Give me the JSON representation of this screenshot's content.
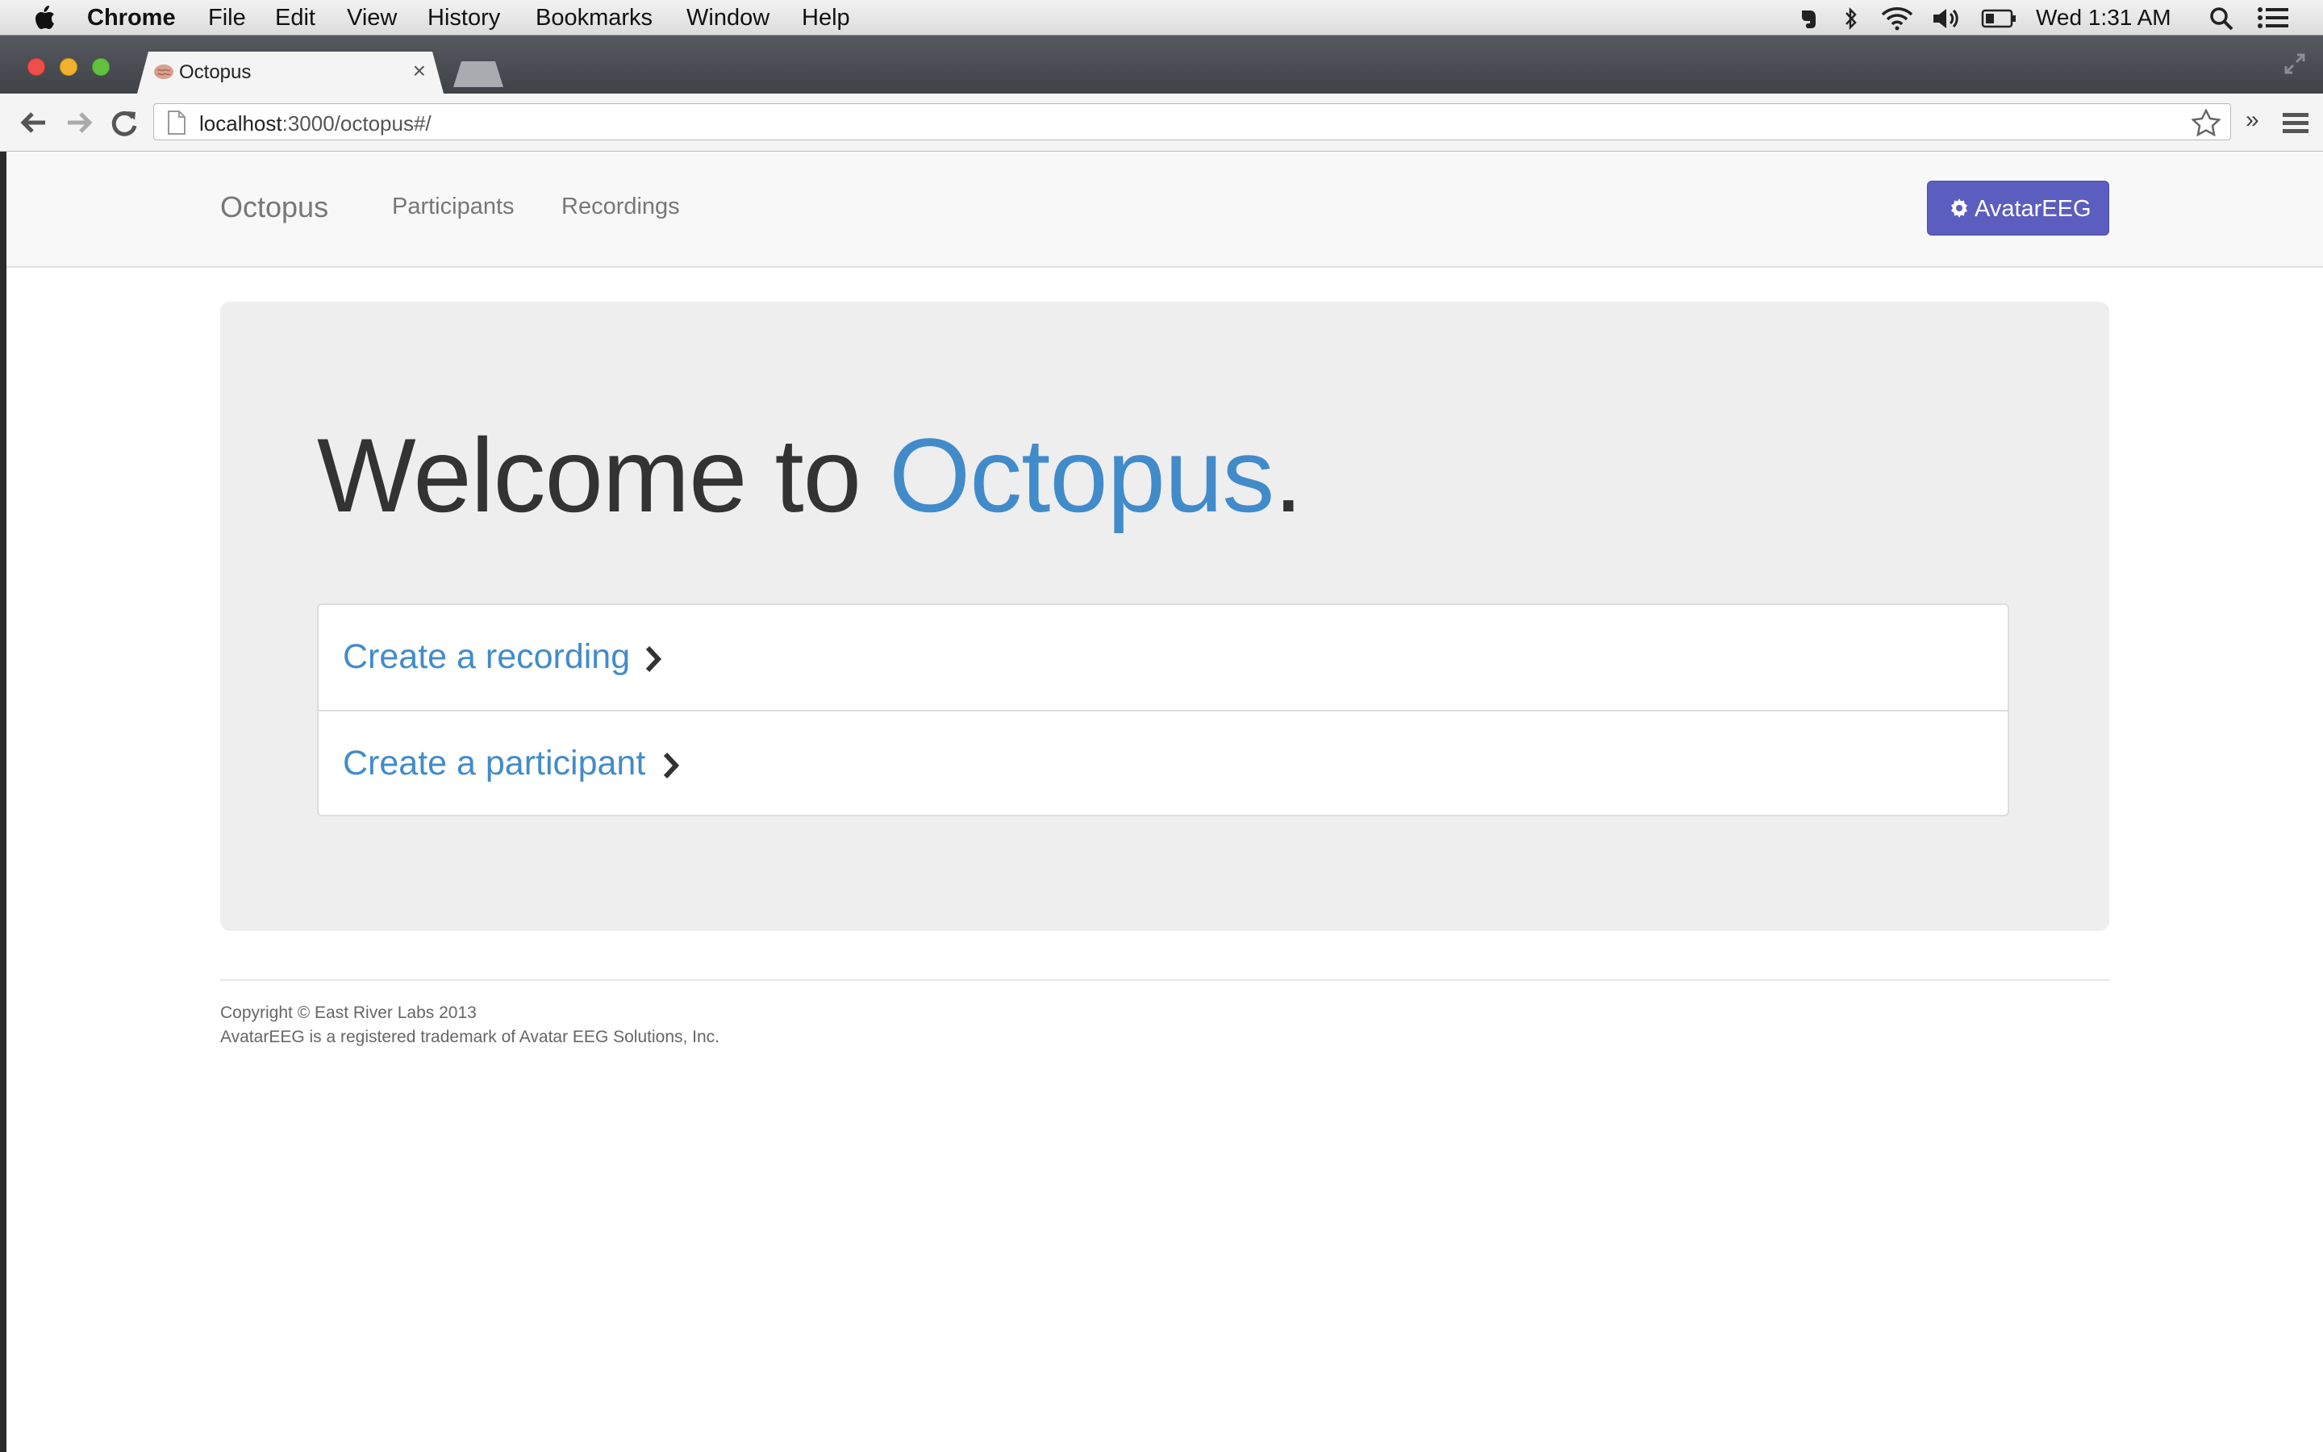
{
  "menubar": {
    "apple": "",
    "app_name": "Chrome",
    "items": [
      "File",
      "Edit",
      "View",
      "History",
      "Bookmarks",
      "Window",
      "Help"
    ],
    "clock": "Wed 1:31 AM",
    "status_icons": [
      "evernote-icon",
      "bluetooth-icon",
      "wifi-icon",
      "volume-icon",
      "battery-icon",
      "spotlight-icon",
      "notification-center-icon"
    ]
  },
  "browser": {
    "tab_title": "Octopus",
    "tab_close": "×",
    "url_host": "localhost",
    "url_path": ":3000/octopus#/",
    "ext_chevron": "»"
  },
  "app": {
    "brand": "Octopus",
    "nav": [
      "Participants",
      "Recordings"
    ],
    "account_button": "AvatarEEG",
    "accent_color": "#428bca",
    "button_color": "#5b5dbf"
  },
  "hero": {
    "prefix": "Welcome to ",
    "accent": "Octopus",
    "suffix": "."
  },
  "actions": [
    {
      "label": "Create a recording"
    },
    {
      "label": "Create a participant"
    }
  ],
  "footer": {
    "copyright": "Copyright © East River Labs 2013",
    "trademark": "AvatarEEG is a registered trademark of Avatar EEG Solutions, Inc."
  }
}
